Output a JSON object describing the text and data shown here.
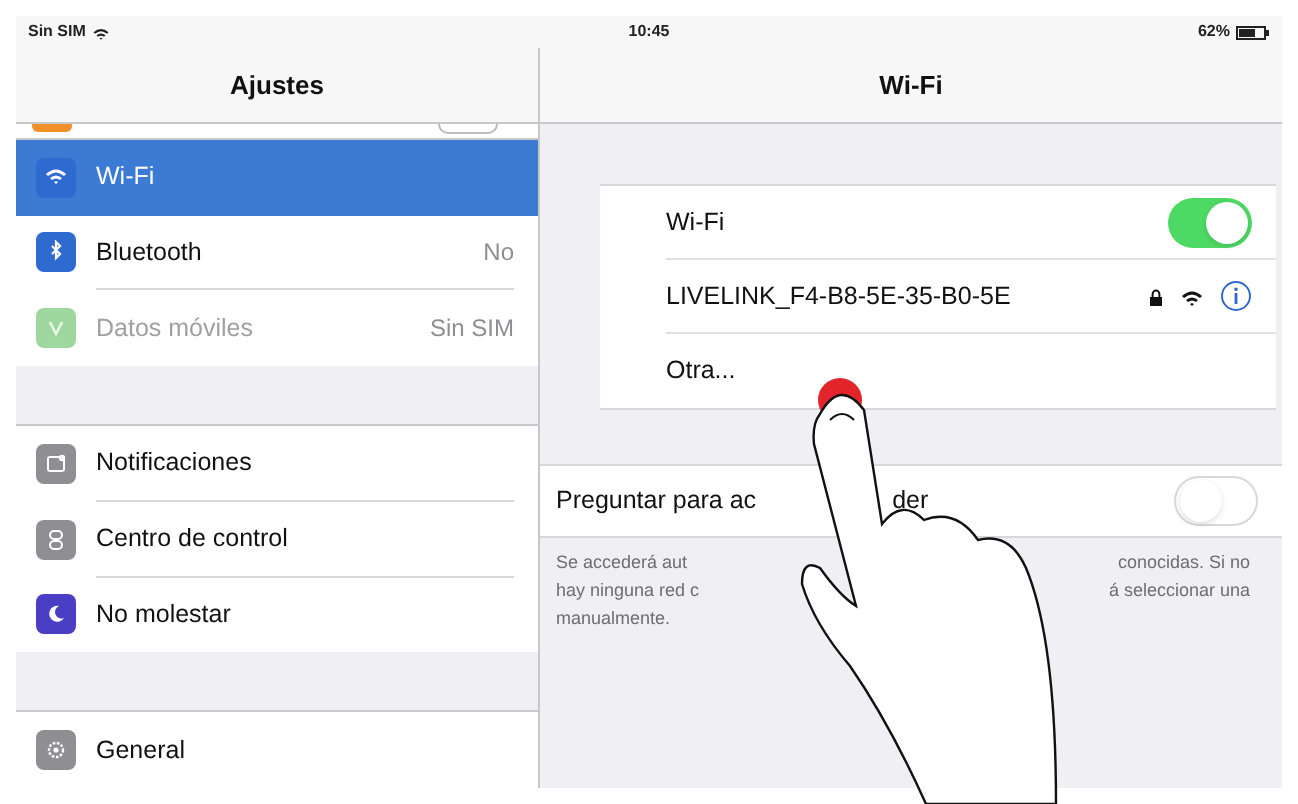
{
  "status_bar": {
    "carrier": "Sin SIM",
    "time": "10:45",
    "battery": "62%"
  },
  "sidebar": {
    "title": "Ajustes",
    "groups": [
      [
        {
          "label": "Wi-Fi",
          "selected": true,
          "disabled": false,
          "color": "#2f6ad0"
        },
        {
          "label": "Bluetooth",
          "value": "No",
          "selected": false,
          "disabled": false,
          "color": "#2f6ad0"
        },
        {
          "label": "Datos móviles",
          "value": "Sin SIM",
          "selected": false,
          "disabled": true,
          "color": "#9fd89f"
        }
      ],
      [
        {
          "label": "Notificaciones",
          "selected": false,
          "disabled": false,
          "color": "#8e8e93"
        },
        {
          "label": "Centro de control",
          "selected": false,
          "disabled": false,
          "color": "#8e8e93"
        },
        {
          "label": "No molestar",
          "selected": false,
          "disabled": false,
          "color": "#4a3fc4"
        }
      ],
      [
        {
          "label": "General",
          "selected": false,
          "disabled": false,
          "color": "#8e8e93"
        }
      ]
    ]
  },
  "detail": {
    "title": "Wi-Fi",
    "rows": [
      {
        "kind": "toggle",
        "label": "Wi-Fi",
        "on": true
      },
      {
        "kind": "network",
        "label": "LIVELINK_F4-B8-5E-35-B0-5E",
        "locked": true
      },
      {
        "kind": "plain",
        "label": "Otra..."
      }
    ],
    "ask_to_join": {
      "label_parts": [
        "Preguntar para ac",
        "der"
      ],
      "on": false
    },
    "footer_lines": [
      [
        "Se accederá aut",
        "conocidas. Si no"
      ],
      [
        "hay ninguna red c",
        "á seleccionar una"
      ],
      [
        "manualmente."
      ]
    ]
  }
}
